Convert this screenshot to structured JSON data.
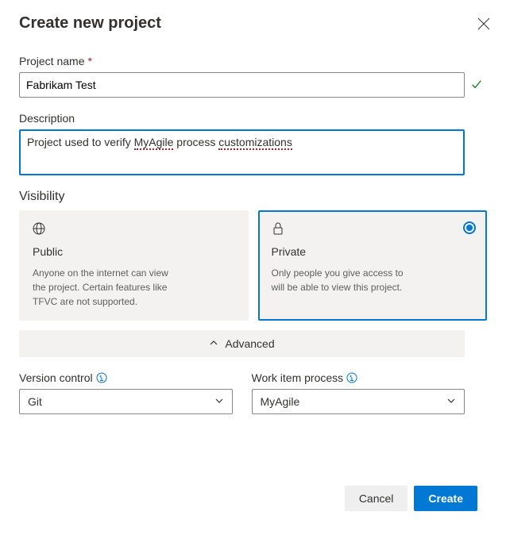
{
  "dialog": {
    "title": "Create new project"
  },
  "projectName": {
    "label": "Project name",
    "value": "Fabrikam Test"
  },
  "description": {
    "label": "Description",
    "value_parts": [
      "Project used to verify ",
      "MyAgile",
      " process ",
      "customizations"
    ]
  },
  "visibility": {
    "label": "Visibility",
    "options": [
      {
        "key": "public",
        "title": "Public",
        "desc": "Anyone on the internet can view the project. Certain features like TFVC are not supported.",
        "selected": false
      },
      {
        "key": "private",
        "title": "Private",
        "desc": "Only people you give access to will be able to view this project.",
        "selected": true
      }
    ]
  },
  "advanced": {
    "label": "Advanced",
    "versionControl": {
      "label": "Version control",
      "value": "Git"
    },
    "workItemProcess": {
      "label": "Work item process",
      "value": "MyAgile"
    }
  },
  "footer": {
    "cancel": "Cancel",
    "create": "Create"
  }
}
